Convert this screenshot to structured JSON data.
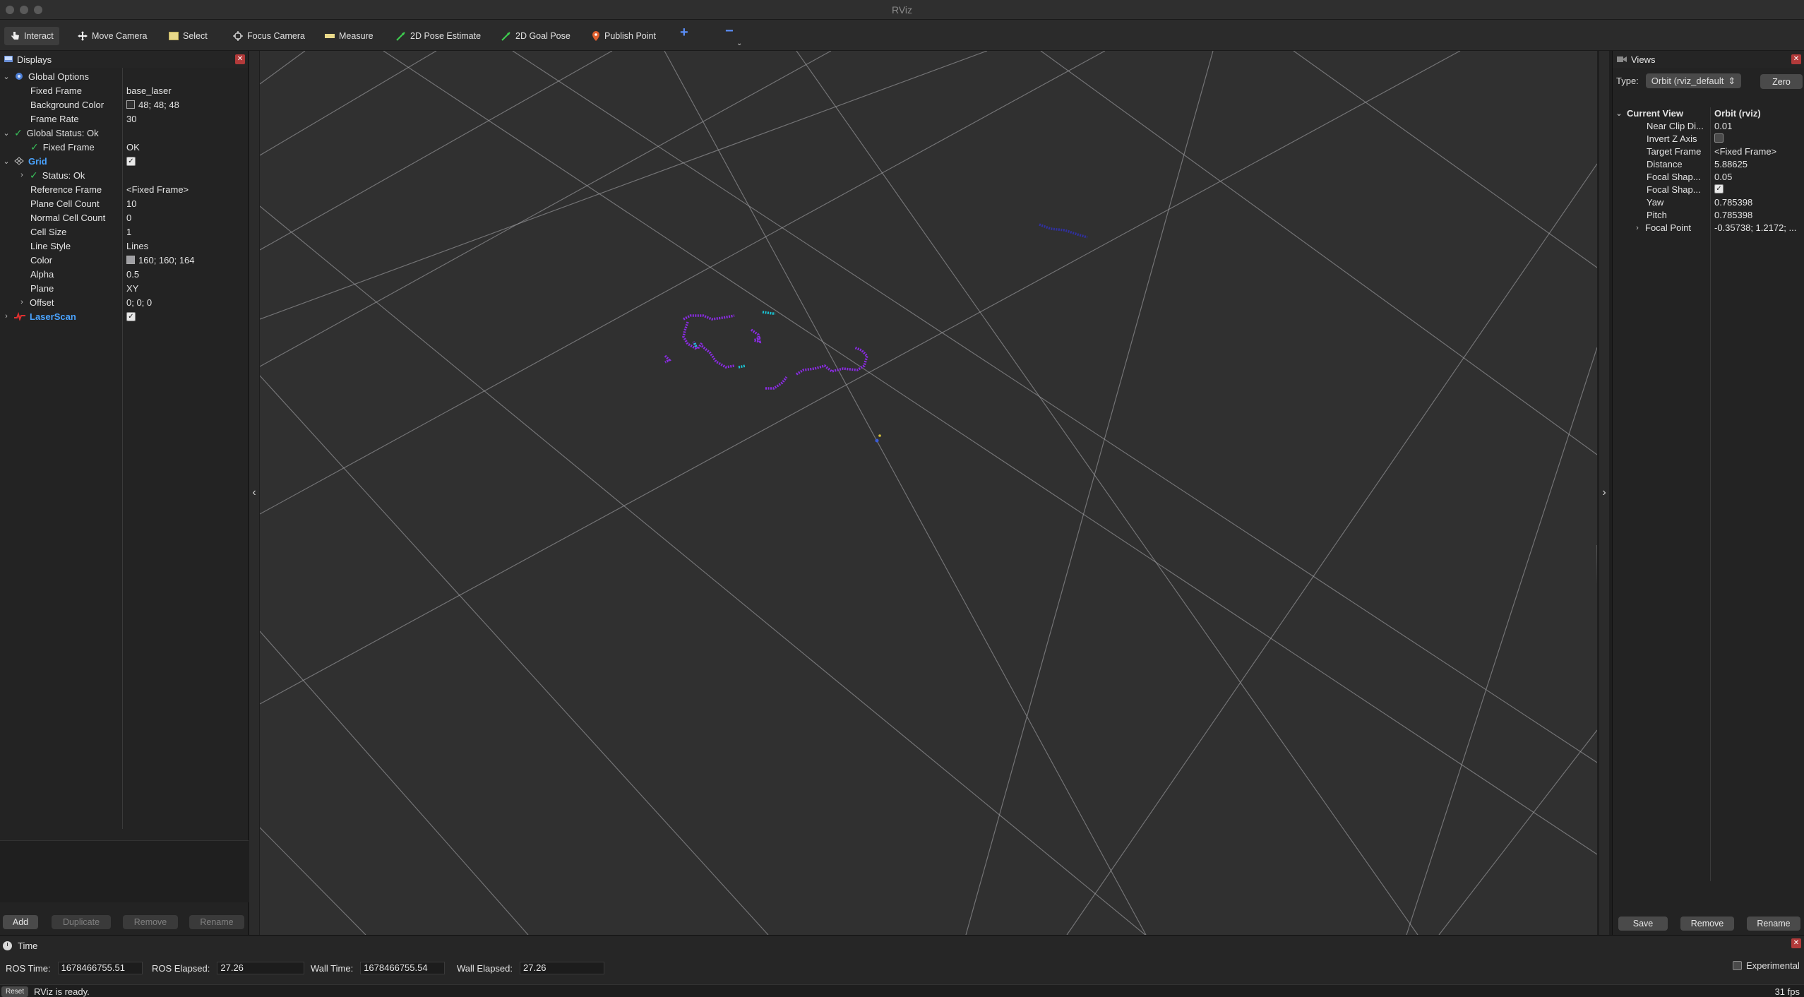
{
  "window": {
    "title": "RViz"
  },
  "toolbar": {
    "tools": [
      {
        "label": "Interact",
        "icon": "hand-pointer-icon"
      },
      {
        "label": "Move Camera",
        "icon": "move-arrows-icon"
      },
      {
        "label": "Select",
        "icon": "select-rectangle-icon"
      },
      {
        "label": "Focus Camera",
        "icon": "crosshair-icon"
      },
      {
        "label": "Measure",
        "icon": "ruler-icon"
      },
      {
        "label": "2D Pose Estimate",
        "icon": "green-arrow-icon"
      },
      {
        "label": "2D Goal Pose",
        "icon": "green-arrow-icon"
      },
      {
        "label": "Publish Point",
        "icon": "map-pin-icon"
      }
    ],
    "add_tool": "+",
    "remove_tool": "−"
  },
  "displays": {
    "title": "Displays",
    "global_options": {
      "label": "Global Options",
      "fixed_frame_key": "Fixed Frame",
      "fixed_frame": "base_laser",
      "background_color_key": "Background Color",
      "background_color": "48; 48; 48",
      "frame_rate_key": "Frame Rate",
      "frame_rate": "30"
    },
    "global_status": {
      "label": "Global Status: Ok",
      "fixed_frame_key": "Fixed Frame",
      "fixed_frame_value": "OK"
    },
    "grid": {
      "label": "Grid",
      "status": "Status: Ok",
      "reference_frame_key": "Reference Frame",
      "reference_frame": "<Fixed Frame>",
      "plane_cell_count_key": "Plane Cell Count",
      "plane_cell_count": "10",
      "normal_cell_count_key": "Normal Cell Count",
      "normal_cell_count": "0",
      "cell_size_key": "Cell Size",
      "cell_size": "1",
      "line_style_key": "Line Style",
      "line_style": "Lines",
      "color_key": "Color",
      "color": "160; 160; 164",
      "alpha_key": "Alpha",
      "alpha": "0.5",
      "plane_key": "Plane",
      "plane": "XY",
      "offset_key": "Offset",
      "offset": "0; 0; 0"
    },
    "laserscan": {
      "label": "LaserScan"
    },
    "buttons": {
      "add": "Add",
      "duplicate": "Duplicate",
      "remove": "Remove",
      "rename": "Rename"
    }
  },
  "views": {
    "title": "Views",
    "type_label": "Type:",
    "type_value": "Orbit (rviz_default",
    "zero_label": "Zero",
    "current_view": {
      "label": "Current View",
      "value": "Orbit (rviz)",
      "near_clip_key": "Near Clip Di...",
      "near_clip": "0.01",
      "invert_z_key": "Invert Z Axis",
      "target_frame_key": "Target Frame",
      "target_frame": "<Fixed Frame>",
      "distance_key": "Distance",
      "distance": "5.88625",
      "focal_shape_size_key": "Focal Shap...",
      "focal_shape_size": "0.05",
      "focal_shape_fixed_key": "Focal Shap...",
      "yaw_key": "Yaw",
      "yaw": "0.785398",
      "pitch_key": "Pitch",
      "pitch": "0.785398",
      "focal_point_key": "Focal Point",
      "focal_point": "-0.35738; 1.2172; ..."
    },
    "buttons": {
      "save": "Save",
      "remove": "Remove",
      "rename": "Rename"
    }
  },
  "time": {
    "title": "Time",
    "ros_time_label": "ROS Time:",
    "ros_time": "1678466755.51",
    "ros_elapsed_label": "ROS Elapsed:",
    "ros_elapsed": "27.26",
    "wall_time_label": "Wall Time:",
    "wall_time": "1678466755.54",
    "wall_elapsed_label": "Wall Elapsed:",
    "wall_elapsed": "27.26",
    "experimental_label": "Experimental"
  },
  "status": {
    "reset_label": "Reset",
    "message": "RViz is ready.",
    "fps": "31 fps"
  },
  "colors": {
    "viewport_bg": "#303030",
    "grid": "#a0a0a4",
    "scan_purple": "#8a2be2",
    "scan_cyan": "#19c6d6",
    "check_green": "#38c15a",
    "link_blue": "#4aa3ff"
  }
}
